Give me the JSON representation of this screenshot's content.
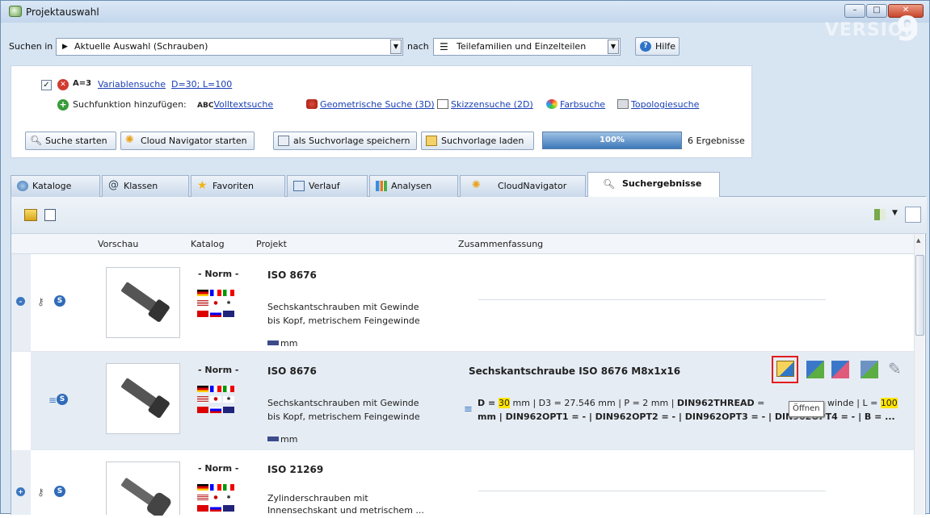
{
  "window": {
    "title": "Projektauswahl",
    "version_label": "VERSION",
    "version_number": "9"
  },
  "search": {
    "label_in": "Suchen in",
    "scope": "Aktuelle Auswahl (Schrauben)",
    "label_by": "nach",
    "target": "Teilefamilien und Einzelteilen",
    "help": "Hilfe"
  },
  "filter": {
    "count_label": "A=3",
    "variable_link": "Variablensuche",
    "variable_values": "D=30; L=100",
    "add_label": "Suchfunktion hinzufügen:",
    "functions": [
      {
        "label": "Volltextsuche",
        "prefix": "ABC",
        "icon": "fulltext-icon"
      },
      {
        "label": "Geometrische Suche (3D)",
        "prefix": "",
        "icon": "geometry-icon"
      },
      {
        "label": "Skizzensuche (2D)",
        "prefix": "",
        "icon": "sketch-icon"
      },
      {
        "label": "Farbsuche",
        "prefix": "",
        "icon": "color-icon"
      },
      {
        "label": "Topologiesuche",
        "prefix": "",
        "icon": "topology-icon"
      }
    ]
  },
  "actions": {
    "start": "Suche starten",
    "cloud": "Cloud Navigator starten",
    "save_template": "als Suchvorlage speichern",
    "load_template": "Suchvorlage laden",
    "progress": "100%",
    "progress_value": 1.0,
    "results": "6 Ergebnisse"
  },
  "tabs": [
    {
      "label": "Kataloge"
    },
    {
      "label": "Klassen"
    },
    {
      "label": "Favoriten"
    },
    {
      "label": "Verlauf"
    },
    {
      "label": "Analysen"
    },
    {
      "label": "CloudNavigator"
    },
    {
      "label": "Suchergebnisse"
    }
  ],
  "columns": {
    "preview": "Vorschau",
    "catalog": "Katalog",
    "project": "Projekt",
    "summary": "Zusammenfassung"
  },
  "rows": [
    {
      "norm": "- Norm -",
      "project": "ISO 8676",
      "desc1": "Sechskantschrauben mit Gewinde",
      "desc2": "bis Kopf, metrischem Feingewinde",
      "unit": "mm"
    },
    {
      "norm": "- Norm -",
      "project": "ISO 8676",
      "desc1": "Sechskantschrauben mit Gewinde",
      "desc2": "bis Kopf, metrischem Feingewinde",
      "unit": "mm",
      "summary_title": "Sechskantschraube ISO 8676 M8x1x16",
      "summary": {
        "d_prefix": "D = ",
        "d_value": "30",
        "d_rest": " mm | D3 = 27.546 mm | P = 2 mm | ",
        "thread_key": "DIN962THREAD",
        "thread_rest": " = ",
        "hidden_after_tooltip": "winde | L = ",
        "l_value": "100",
        "line2": "mm | DIN962OPT1 = - | DIN962OPT2 = - | DIN962OPT3 = - | DIN962OPT4 = - | B = ..."
      }
    },
    {
      "norm": "- Norm -",
      "project": "ISO 21269",
      "desc1": "Zylinderschrauben mit",
      "desc2": "Innensechskant und metrischem ..."
    }
  ],
  "tooltip": "Öffnen"
}
